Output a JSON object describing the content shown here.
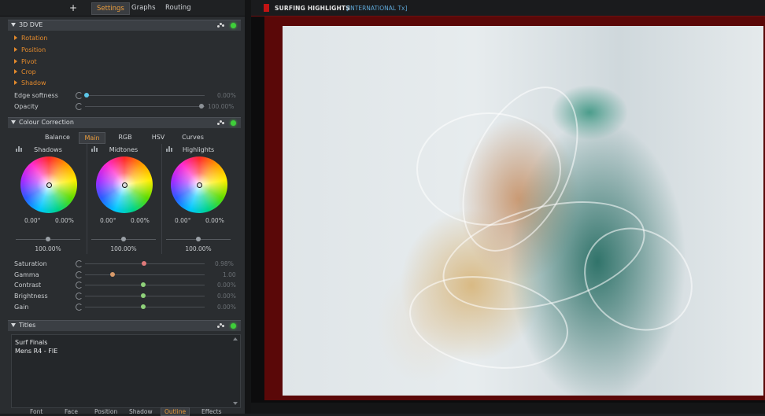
{
  "top": {
    "plus": "+",
    "tabs": [
      {
        "label": "Settings",
        "active": true
      },
      {
        "label": "Graphs",
        "active": false
      },
      {
        "label": "Routing",
        "active": false
      }
    ]
  },
  "dve": {
    "title": "3D DVE",
    "items": [
      "Rotation",
      "Position",
      "Pivot",
      "Crop",
      "Shadow"
    ],
    "edge_softness": {
      "label": "Edge softness",
      "value": "0.00%",
      "level": 0
    },
    "opacity": {
      "label": "Opacity",
      "value": "100.00%",
      "level": 1
    }
  },
  "colour": {
    "title": "Colour Correction",
    "tabs": [
      {
        "label": "Balance",
        "active": false
      },
      {
        "label": "Main",
        "active": true
      },
      {
        "label": "RGB",
        "active": false
      },
      {
        "label": "HSV",
        "active": false
      },
      {
        "label": "Curves",
        "active": false
      }
    ],
    "wheels": [
      {
        "name": "Shadows",
        "hue": "0.00°",
        "sat": "0.00%",
        "level": "100.00%"
      },
      {
        "name": "Midtones",
        "hue": "0.00°",
        "sat": "0.00%",
        "level": "100.00%"
      },
      {
        "name": "Highlights",
        "hue": "0.00°",
        "sat": "0.00%",
        "level": "100.00%"
      }
    ],
    "params": [
      {
        "label": "Saturation",
        "value": "0.98%",
        "knob_color": "#e07a7a",
        "pos": 0.55
      },
      {
        "label": "Gamma",
        "value": "1.00",
        "knob_color": "#d89a6a",
        "pos": 0.22
      },
      {
        "label": "Contrast",
        "value": "0.00%",
        "knob_color": "#8fd27a",
        "pos": 0.5
      },
      {
        "label": "Brightness",
        "value": "0.00%",
        "knob_color": "#8fd27a",
        "pos": 0.5
      },
      {
        "label": "Gain",
        "value": "0.00%",
        "knob_color": "#8fd27a",
        "pos": 0.5
      }
    ]
  },
  "titles": {
    "title": "Titles",
    "lines": [
      "Surf Finals",
      "Mens R4 - FIE"
    ]
  },
  "bottom_tabs": [
    {
      "label": "Font",
      "active": false
    },
    {
      "label": "Face",
      "active": false
    },
    {
      "label": "Position",
      "active": false
    },
    {
      "label": "Shadow",
      "active": false
    },
    {
      "label": "Outline",
      "active": true
    },
    {
      "label": "Effects",
      "active": false
    }
  ],
  "viewer": {
    "name": "SURFING HIGHLIGHTS",
    "channel": "[INTERNATIONAL Tx]"
  },
  "colors": {
    "accent": "#e89b3c",
    "orange_item": "#e48a2c",
    "led": "#3fce3a",
    "tally": "#c21414",
    "channel": "#5fa8d8"
  }
}
